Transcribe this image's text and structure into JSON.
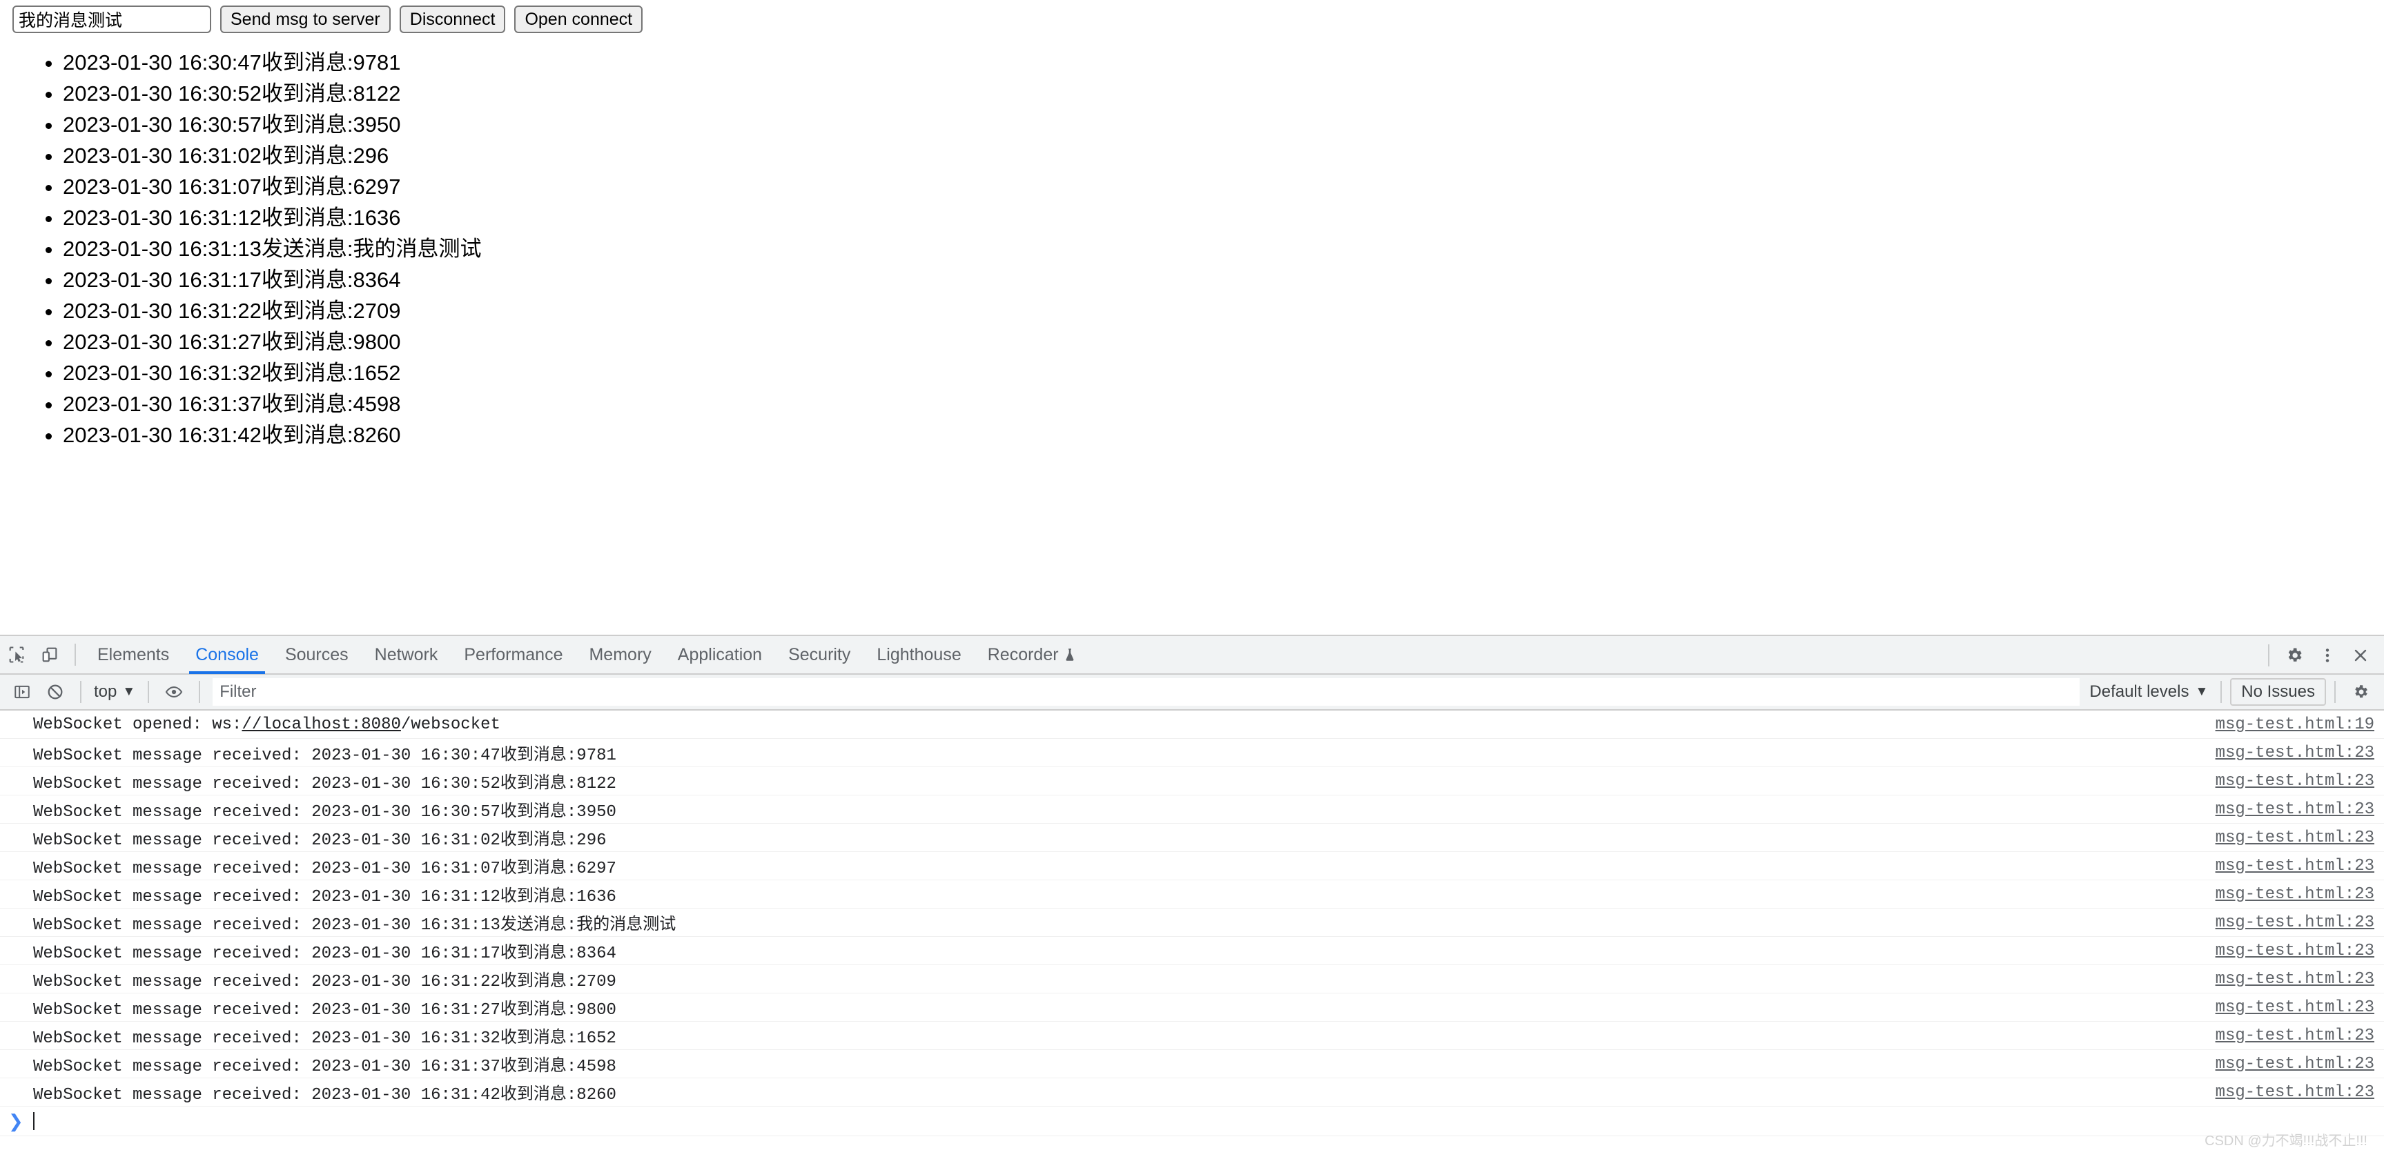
{
  "page": {
    "message_input": {
      "value": "我的消息测试",
      "placeholder": ""
    },
    "buttons": [
      {
        "label": "Send msg to server",
        "name": "send-msg-button"
      },
      {
        "label": "Disconnect",
        "name": "disconnect-button"
      },
      {
        "label": "Open connect",
        "name": "open-connect-button"
      }
    ],
    "messages": [
      "2023-01-30 16:30:47收到消息:9781",
      "2023-01-30 16:30:52收到消息:8122",
      "2023-01-30 16:30:57收到消息:3950",
      "2023-01-30 16:31:02收到消息:296",
      "2023-01-30 16:31:07收到消息:6297",
      "2023-01-30 16:31:12收到消息:1636",
      "2023-01-30 16:31:13发送消息:我的消息测试",
      "2023-01-30 16:31:17收到消息:8364",
      "2023-01-30 16:31:22收到消息:2709",
      "2023-01-30 16:31:27收到消息:9800",
      "2023-01-30 16:31:32收到消息:1652",
      "2023-01-30 16:31:37收到消息:4598",
      "2023-01-30 16:31:42收到消息:8260"
    ]
  },
  "devtools": {
    "left_icons": [
      {
        "name": "inspect-element-icon"
      },
      {
        "name": "device-toolbar-icon"
      }
    ],
    "tabs": [
      {
        "label": "Elements",
        "active": false
      },
      {
        "label": "Console",
        "active": true
      },
      {
        "label": "Sources",
        "active": false
      },
      {
        "label": "Network",
        "active": false
      },
      {
        "label": "Performance",
        "active": false
      },
      {
        "label": "Memory",
        "active": false
      },
      {
        "label": "Application",
        "active": false
      },
      {
        "label": "Security",
        "active": false
      },
      {
        "label": "Lighthouse",
        "active": false
      },
      {
        "label": "Recorder",
        "active": false
      }
    ],
    "recorder_badge_icon": "flask-icon",
    "right_icons": [
      {
        "name": "settings-gear-icon"
      },
      {
        "name": "more-options-icon"
      },
      {
        "name": "close-devtools-icon"
      }
    ],
    "filterbar": {
      "sidebar_toggle_icon": "console-sidebar-icon",
      "clear_icon": "clear-console-icon",
      "context": "top",
      "context_caret": "▼",
      "eye_icon": "live-expression-eye-icon",
      "filter_placeholder": "Filter",
      "filter_value": "",
      "levels": "Default levels",
      "levels_caret": "▼",
      "issues": "No Issues",
      "settings_icon": "console-settings-gear-icon"
    },
    "console": {
      "entries": [
        {
          "prefix": "WebSocket opened: ws:",
          "link": "//localhost:8080",
          "suffix": "/websocket",
          "source": "msg-test.html:19"
        },
        {
          "text": "WebSocket message received: 2023-01-30 16:30:47收到消息:9781",
          "source": "msg-test.html:23"
        },
        {
          "text": "WebSocket message received: 2023-01-30 16:30:52收到消息:8122",
          "source": "msg-test.html:23"
        },
        {
          "text": "WebSocket message received: 2023-01-30 16:30:57收到消息:3950",
          "source": "msg-test.html:23"
        },
        {
          "text": "WebSocket message received: 2023-01-30 16:31:02收到消息:296",
          "source": "msg-test.html:23"
        },
        {
          "text": "WebSocket message received: 2023-01-30 16:31:07收到消息:6297",
          "source": "msg-test.html:23"
        },
        {
          "text": "WebSocket message received: 2023-01-30 16:31:12收到消息:1636",
          "source": "msg-test.html:23"
        },
        {
          "text": "WebSocket message received: 2023-01-30 16:31:13发送消息:我的消息测试",
          "source": "msg-test.html:23"
        },
        {
          "text": "WebSocket message received: 2023-01-30 16:31:17收到消息:8364",
          "source": "msg-test.html:23"
        },
        {
          "text": "WebSocket message received: 2023-01-30 16:31:22收到消息:2709",
          "source": "msg-test.html:23"
        },
        {
          "text": "WebSocket message received: 2023-01-30 16:31:27收到消息:9800",
          "source": "msg-test.html:23"
        },
        {
          "text": "WebSocket message received: 2023-01-30 16:31:32收到消息:1652",
          "source": "msg-test.html:23"
        },
        {
          "text": "WebSocket message received: 2023-01-30 16:31:37收到消息:4598",
          "source": "msg-test.html:23"
        },
        {
          "text": "WebSocket message received: 2023-01-30 16:31:42收到消息:8260",
          "source": "msg-test.html:23"
        }
      ],
      "prompt_chevron": "❯"
    }
  },
  "watermark": "CSDN @力不竭!!!战不止!!!",
  "colors": {
    "accent": "#1a73e8",
    "prompt": "#4285f4",
    "toolbar_bg": "#f1f3f4",
    "text": "#202124",
    "muted": "#5f6368"
  }
}
